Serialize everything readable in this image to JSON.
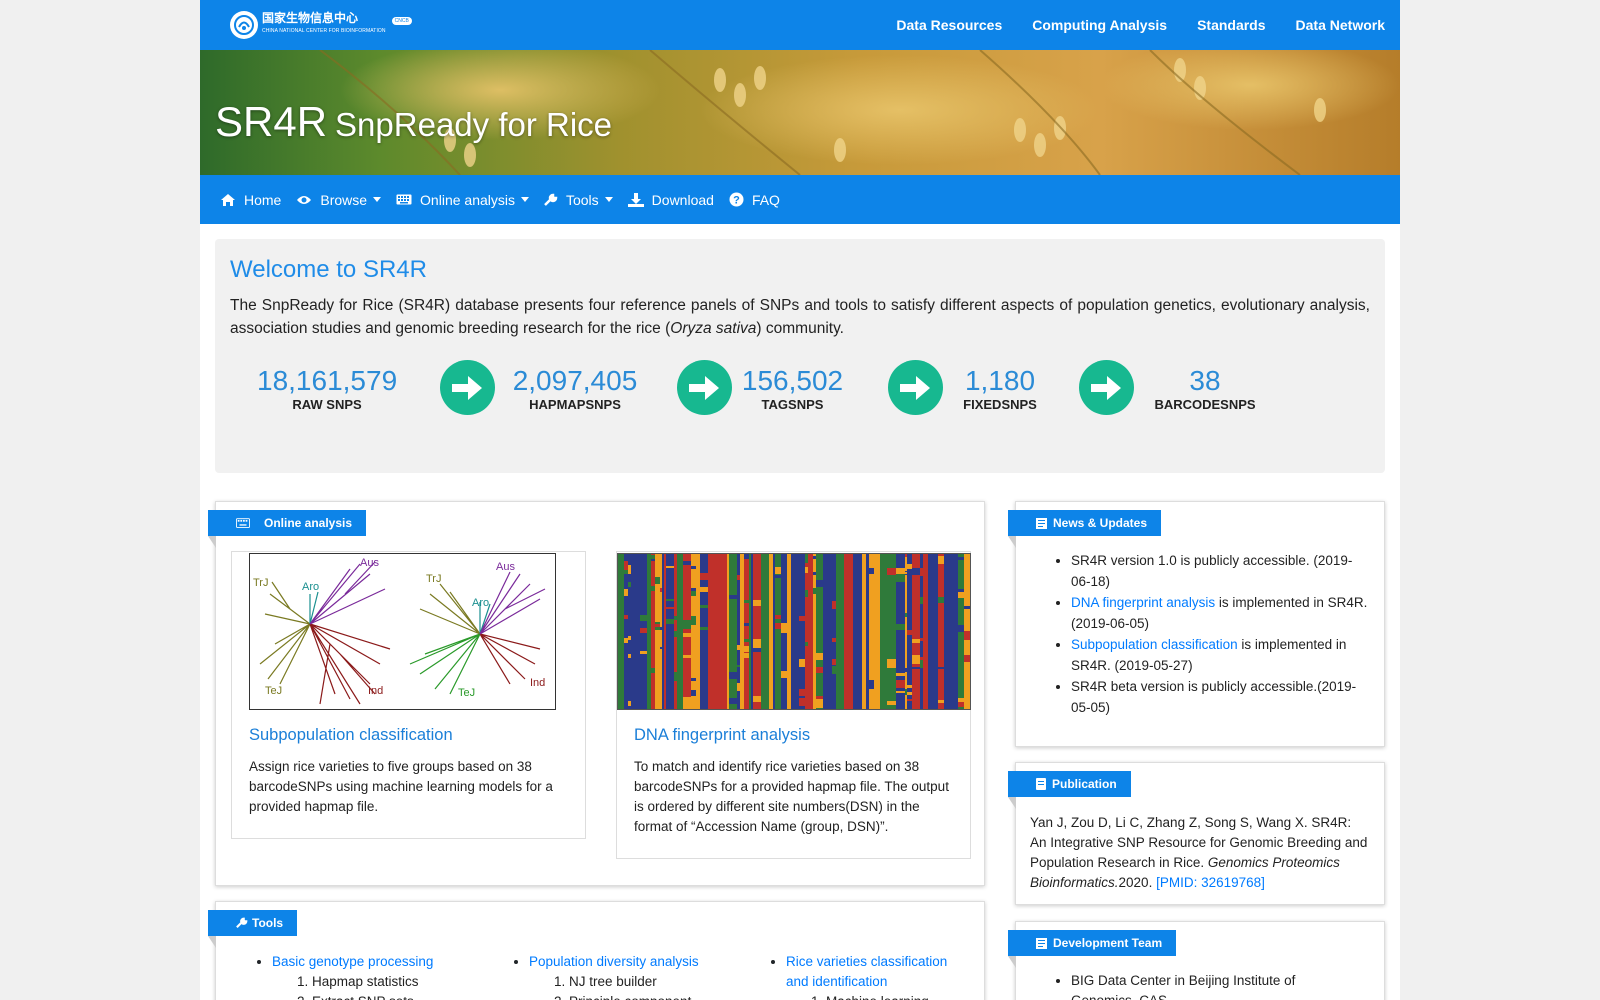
{
  "topbar": {
    "logo_text": "国家生物信息中心",
    "logo_subtext": "CHINA NATIONAL CENTER FOR BIOINFORMATION",
    "logo_tag": "CNCB",
    "nav": [
      "Data Resources",
      "Computing Analysis",
      "Standards",
      "Data Network"
    ]
  },
  "banner": {
    "title": "SR4R",
    "subtitle": "SnpReady for Rice"
  },
  "menu": [
    {
      "label": "Home",
      "icon": "home-icon",
      "dropdown": false
    },
    {
      "label": "Browse",
      "icon": "eye-icon",
      "dropdown": true
    },
    {
      "label": "Online analysis",
      "icon": "keyboard-icon",
      "dropdown": true
    },
    {
      "label": "Tools",
      "icon": "wrench-icon",
      "dropdown": true
    },
    {
      "label": "Download",
      "icon": "download-icon",
      "dropdown": false
    },
    {
      "label": "FAQ",
      "icon": "question-icon",
      "dropdown": false
    }
  ],
  "welcome": {
    "title": "Welcome to SR4R",
    "text_before": "The SnpReady for Rice (SR4R) database presents four reference panels of SNPs and tools to satisfy different aspects of population genetics, evolutionary analysis, association studies and genomic breeding research for the rice (",
    "text_italic": "Oryza sativa",
    "text_after": ") community."
  },
  "stats": [
    {
      "value": "18,161,579",
      "label": "RAW SNPS"
    },
    {
      "value": "2,097,405",
      "label": "HAPMAPSNPS"
    },
    {
      "value": "156,502",
      "label": "TAGSNPS"
    },
    {
      "value": "1,180",
      "label": "FIXEDSNPS"
    },
    {
      "value": "38",
      "label": "BARCODESNPS"
    }
  ],
  "online_analysis": {
    "tag": "Online analysis",
    "cards": [
      {
        "title": "Subpopulation classification",
        "desc": "Assign rice varieties to five groups based on 38 barcodeSNPs using machine learning models for a provided hapmap file.",
        "tree_labels": [
          "TrJ",
          "Aro",
          "Aus",
          "TeJ",
          "Ind",
          "TrJ",
          "Aro",
          "Aus",
          "TeJ",
          "Ind"
        ]
      },
      {
        "title": "DNA fingerprint analysis",
        "desc": "To match and identify rice varieties based on 38 barcodeSNPs for a provided hapmap file. The output is ordered by different site numbers(DSN) in the format of “Accession Name (group, DSN)”."
      }
    ]
  },
  "news": {
    "tag": "News & Updates",
    "items": [
      {
        "link": "",
        "text": "SR4R version 1.0 is publicly accessible. (2019-06-18)"
      },
      {
        "link": "DNA fingerprint analysis",
        "text": " is implemented in SR4R. (2019-06-05)"
      },
      {
        "link": "Subpopulation classification",
        "text": " is implemented in SR4R. (2019-05-27)"
      },
      {
        "link": "",
        "text": "SR4R beta version is publicly accessible.(2019-05-05)"
      }
    ]
  },
  "publication": {
    "tag": "Publication",
    "text": "Yan J, Zou D, Li C, Zhang Z, Song S, Wang X. SR4R: An Integrative SNP Resource for Genomic Breeding and Population Research in Rice. ",
    "journal": "Genomics Proteomics Bioinformatics.",
    "year": "2020. ",
    "pmid": "[PMID: 32619768]"
  },
  "team": {
    "tag": "Development Team",
    "items": [
      "BIG Data Center in Beijing Institute of Genomics, CAS"
    ]
  },
  "tools": {
    "tag": "Tools",
    "columns": [
      {
        "title": "Basic genotype processing",
        "items": [
          "Hapmap statistics",
          "Extract SNP sets"
        ]
      },
      {
        "title": "Population diversity analysis",
        "items": [
          "NJ tree builder",
          "Principle component"
        ]
      },
      {
        "title": "Rice varieties classification and identification",
        "items": [
          "Machine learning"
        ]
      }
    ]
  },
  "colors": {
    "primary": "#0d84e8",
    "accent_green": "#17b890",
    "link": "#007bff"
  }
}
